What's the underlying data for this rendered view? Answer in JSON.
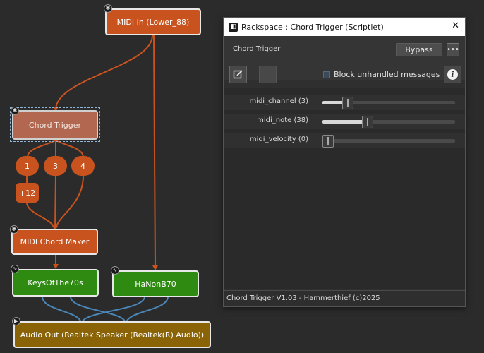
{
  "graph": {
    "nodes": {
      "midi_in": {
        "label": "MIDI In (Lower_88)"
      },
      "chord_trigger": {
        "label": "Chord Trigger"
      },
      "midi_chord_maker": {
        "label": "MIDI Chord Maker"
      },
      "keys": {
        "label": "KeysOfThe70s"
      },
      "hanon": {
        "label": "HaNonB70"
      },
      "audio_out": {
        "label": "Audio Out (Realtek Speaker (Realtek(R) Audio))"
      }
    },
    "pills": [
      "1",
      "3",
      "4",
      "+12"
    ],
    "colors": {
      "midi_wire": "#c8531f",
      "audio_wire": "#4a86b8",
      "plugin_node": "#c8531f",
      "instrument_node": "#2f8a12",
      "output_node": "#8a6306"
    }
  },
  "window": {
    "title": "Rackspace : Chord Trigger (Scriptlet)",
    "close_glyph": "✕",
    "plugin_name": "Chord Trigger",
    "bypass_label": "Bypass",
    "more_label": "•••",
    "block_unhandled_label": "Block unhandled messages",
    "block_unhandled_checked": false,
    "info_glyph": "i",
    "params": [
      {
        "label": "midi_channel (3)",
        "level": 0.15
      },
      {
        "label": "midi_note (38)",
        "level": 0.3
      },
      {
        "label": "midi_velocity (0)",
        "level": 0.0
      }
    ],
    "footer": "Chord Trigger V1.03 - Hammerthief (c)2025"
  }
}
